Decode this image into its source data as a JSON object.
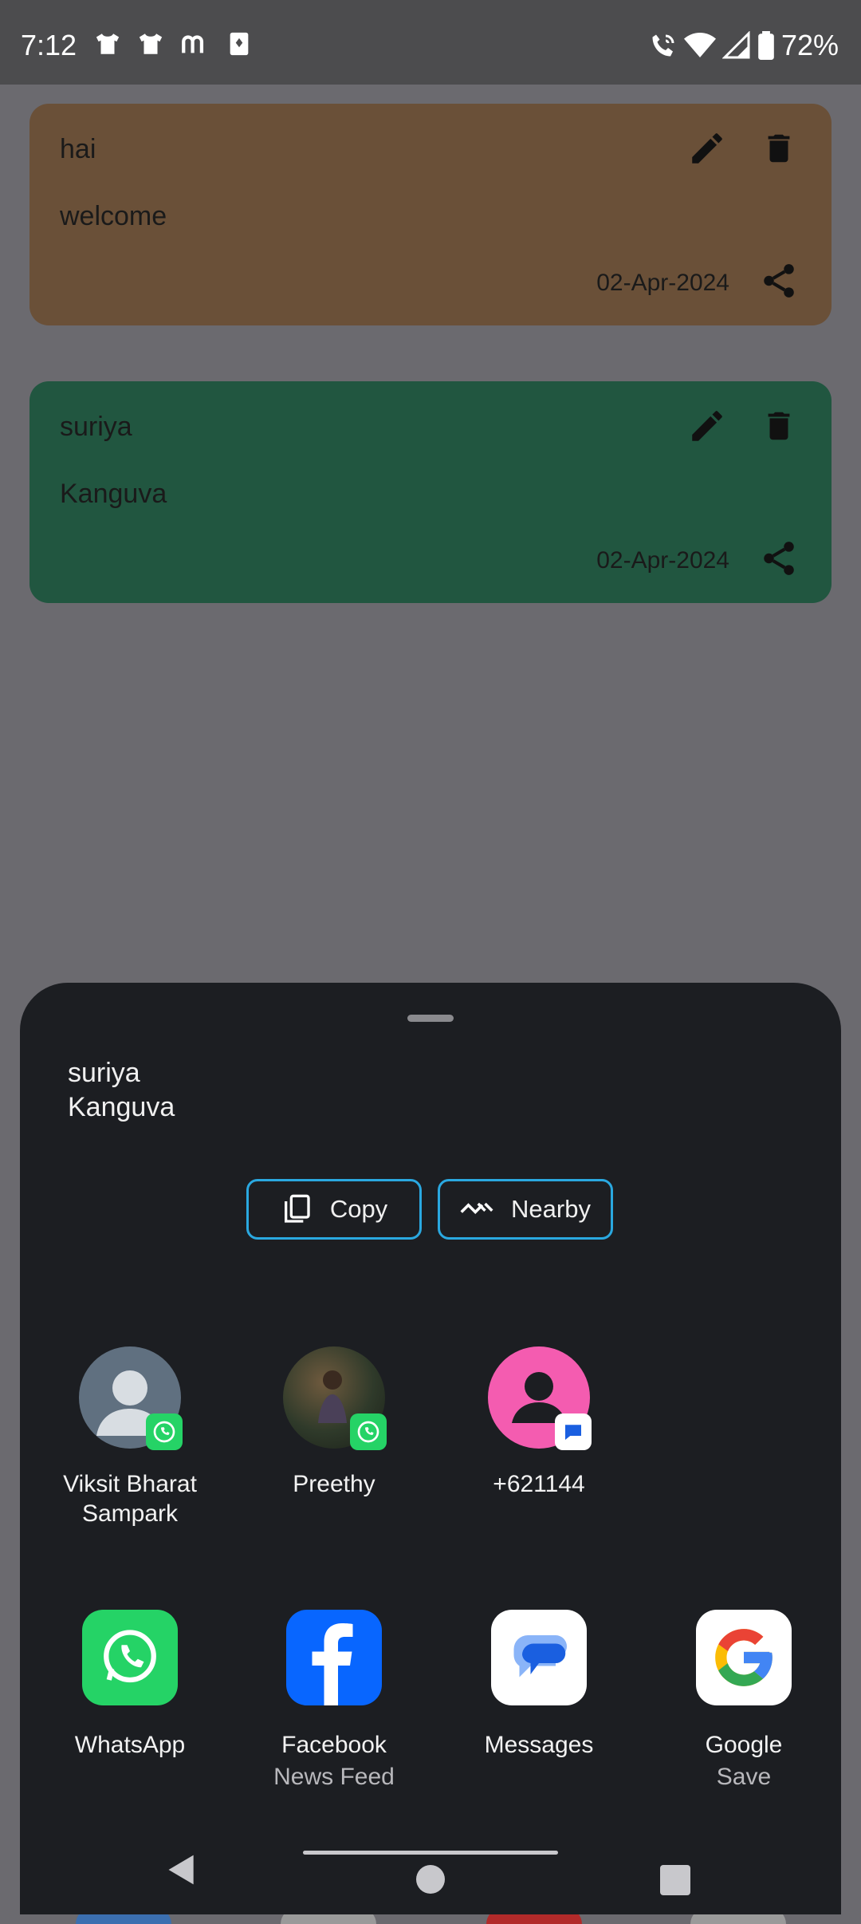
{
  "status_bar": {
    "time": "7:12",
    "battery": "72%",
    "notification_icons": [
      "shirt-icon",
      "shirt-icon",
      "m-app-icon",
      "card-game-icon"
    ],
    "system_icons": [
      "wifi-calling-icon",
      "wifi-icon",
      "signal-icon",
      "battery-icon"
    ]
  },
  "notes": [
    {
      "title": "hai",
      "body": "welcome",
      "date": "02-Apr-2024",
      "color": "#6a5038"
    },
    {
      "title": "suriya",
      "body": "Kanguva",
      "date": "02-Apr-2024",
      "color": "#215640"
    }
  ],
  "share_sheet": {
    "title_line1": "suriya",
    "title_line2": "Kanguva",
    "actions": {
      "copy": "Copy",
      "nearby": "Nearby"
    },
    "direct_targets": [
      {
        "line1": "Viksit Bharat",
        "line2": "Sampark",
        "badge": "whatsapp-badge-icon"
      },
      {
        "line1": "Preethy",
        "line2": "",
        "badge": "whatsapp-badge-icon"
      },
      {
        "line1": "+621144",
        "line2": "",
        "badge": "messages-badge-icon"
      }
    ],
    "apps": [
      {
        "name": "WhatsApp",
        "sub": "",
        "color": "#25d366"
      },
      {
        "name": "Facebook",
        "sub": "News Feed",
        "color": "#0866ff"
      },
      {
        "name": "Messages",
        "sub": "",
        "color": "#ffffff"
      },
      {
        "name": "Google",
        "sub": "Save",
        "color": "#ffffff"
      }
    ]
  },
  "colors": {
    "accent": "#2aa8e0",
    "sheet": "#1c1e22",
    "scrim": "#6b6a6f"
  }
}
